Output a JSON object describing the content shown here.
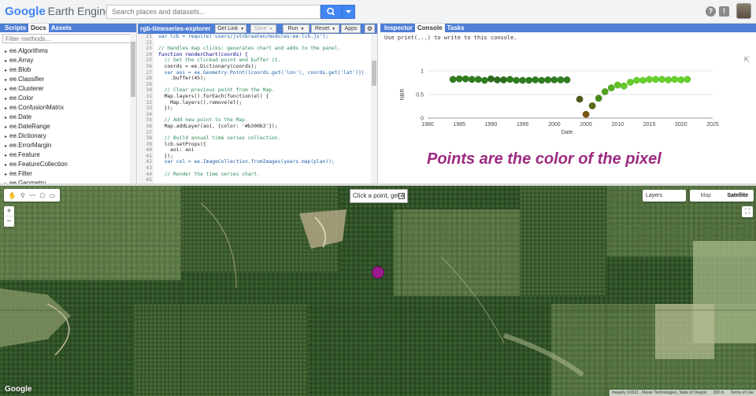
{
  "topbar": {
    "logo_google": "Google",
    "logo_product": "Earth Engine",
    "search_placeholder": "Search places and datasets...",
    "help_icon": "?",
    "feedback_icon": "!"
  },
  "left_panel": {
    "tabs": [
      "Scripts",
      "Docs",
      "Assets"
    ],
    "active_tab": "Docs",
    "filter_placeholder": "Filter methods...",
    "methods": [
      "ee.Algorithms",
      "ee.Array",
      "ee.Blob",
      "ee.Classifier",
      "ee.Clusterer",
      "ee.Color",
      "ee.ConfusionMatrix",
      "ee.Date",
      "ee.DateRange",
      "ee.Dictionary",
      "ee.ErrorMargin",
      "ee.Feature",
      "ee.FeatureCollection",
      "ee.Filter",
      "ee.Geometry"
    ]
  },
  "editor": {
    "title": "rgb-timeseries-explorer",
    "buttons": {
      "get_link": "Get Link",
      "save": "Save",
      "run": "Run",
      "reset": "Reset",
      "apps": "Apps"
    },
    "lines": [
      {
        "n": "21",
        "text": "var lcb = require('users/jstnbraaten/modules:ee-lcb.js');"
      },
      {
        "n": "22",
        "text": ""
      },
      {
        "n": "23",
        "text": "// Handles map clicks: generates chart and adds to the panel."
      },
      {
        "n": "24",
        "text": "function renderChart(coords) {"
      },
      {
        "n": "25",
        "text": "  // Get the clicked point and buffer it."
      },
      {
        "n": "26",
        "text": "  coords = ee.Dictionary(coords);"
      },
      {
        "n": "27",
        "text": "  var aoi = ee.Geometry.Point([coords.get('lon'), coords.get('lat')])"
      },
      {
        "n": "28",
        "text": "    .buffer(45);"
      },
      {
        "n": "29",
        "text": ""
      },
      {
        "n": "30",
        "text": "  // Clear previous point from the Map."
      },
      {
        "n": "31",
        "text": "  Map.layers().forEach(function(el) {"
      },
      {
        "n": "32",
        "text": "    Map.layers().remove(el);"
      },
      {
        "n": "33",
        "text": "  });"
      },
      {
        "n": "34",
        "text": ""
      },
      {
        "n": "35",
        "text": "  // Add new point to the Map."
      },
      {
        "n": "36",
        "text": "  Map.addLayer(aoi, {color: '#b300b3'});"
      },
      {
        "n": "37",
        "text": ""
      },
      {
        "n": "38",
        "text": "  // Build annual time series collection."
      },
      {
        "n": "39",
        "text": "  lcb.setProps({"
      },
      {
        "n": "40",
        "text": "    aoi: aoi"
      },
      {
        "n": "41",
        "text": "  });"
      },
      {
        "n": "42",
        "text": "  var col = ee.ImageCollection.fromImages(years.map(plan));"
      },
      {
        "n": "43",
        "text": ""
      },
      {
        "n": "44",
        "text": "  // Render the time series chart."
      },
      {
        "n": "45",
        "text": ""
      }
    ]
  },
  "right_panel": {
    "tabs": [
      "Inspector",
      "Console",
      "Tasks"
    ],
    "active_tab": "Console",
    "hint": "Use print(...) to write to this console.",
    "caption": "Points are the color of the pixel"
  },
  "chart_data": {
    "type": "scatter",
    "xlabel": "Date",
    "ylabel": "NBR",
    "xlim": [
      1980,
      2025
    ],
    "ylim": [
      0,
      1.0
    ],
    "xticks": [
      1980,
      1985,
      1990,
      1995,
      2000,
      2005,
      2010,
      2015,
      2020,
      2025
    ],
    "yticks": [
      0,
      0.5,
      1.0
    ],
    "points": [
      {
        "x": 1984,
        "y": 0.82,
        "color": "#2e7d1e"
      },
      {
        "x": 1985,
        "y": 0.83,
        "color": "#2e7d1e"
      },
      {
        "x": 1986,
        "y": 0.83,
        "color": "#2e7d1e"
      },
      {
        "x": 1987,
        "y": 0.82,
        "color": "#2e7d1e"
      },
      {
        "x": 1988,
        "y": 0.82,
        "color": "#2e7d1e"
      },
      {
        "x": 1989,
        "y": 0.8,
        "color": "#2e7d1e"
      },
      {
        "x": 1990,
        "y": 0.83,
        "color": "#2c6b1c"
      },
      {
        "x": 1991,
        "y": 0.81,
        "color": "#2c6b1c"
      },
      {
        "x": 1992,
        "y": 0.81,
        "color": "#2c6b1c"
      },
      {
        "x": 1993,
        "y": 0.82,
        "color": "#2e7d1e"
      },
      {
        "x": 1994,
        "y": 0.8,
        "color": "#2e7d1e"
      },
      {
        "x": 1995,
        "y": 0.8,
        "color": "#2e7d1e"
      },
      {
        "x": 1996,
        "y": 0.8,
        "color": "#2e7d1e"
      },
      {
        "x": 1997,
        "y": 0.81,
        "color": "#2e7d1e"
      },
      {
        "x": 1998,
        "y": 0.8,
        "color": "#2e7d1e"
      },
      {
        "x": 1999,
        "y": 0.81,
        "color": "#2e7d1e"
      },
      {
        "x": 2000,
        "y": 0.81,
        "color": "#2e7d1e"
      },
      {
        "x": 2001,
        "y": 0.81,
        "color": "#2e7d1e"
      },
      {
        "x": 2002,
        "y": 0.81,
        "color": "#2e7d1e"
      },
      {
        "x": 2004,
        "y": 0.4,
        "color": "#4d5a15"
      },
      {
        "x": 2005,
        "y": 0.08,
        "color": "#7a5a10"
      },
      {
        "x": 2006,
        "y": 0.26,
        "color": "#5a6a12"
      },
      {
        "x": 2007,
        "y": 0.42,
        "color": "#4a8a1a"
      },
      {
        "x": 2008,
        "y": 0.56,
        "color": "#52a020"
      },
      {
        "x": 2009,
        "y": 0.64,
        "color": "#58b022"
      },
      {
        "x": 2010,
        "y": 0.7,
        "color": "#5ec226"
      },
      {
        "x": 2011,
        "y": 0.68,
        "color": "#60c828"
      },
      {
        "x": 2012,
        "y": 0.76,
        "color": "#64cc2a"
      },
      {
        "x": 2013,
        "y": 0.8,
        "color": "#66d02c"
      },
      {
        "x": 2014,
        "y": 0.8,
        "color": "#66d02c"
      },
      {
        "x": 2015,
        "y": 0.82,
        "color": "#66d02c"
      },
      {
        "x": 2016,
        "y": 0.82,
        "color": "#66d02c"
      },
      {
        "x": 2017,
        "y": 0.82,
        "color": "#66d02c"
      },
      {
        "x": 2018,
        "y": 0.81,
        "color": "#66d02c"
      },
      {
        "x": 2019,
        "y": 0.82,
        "color": "#66d02c"
      },
      {
        "x": 2020,
        "y": 0.81,
        "color": "#66d02c"
      },
      {
        "x": 2021,
        "y": 0.82,
        "color": "#66d02c"
      }
    ]
  },
  "map": {
    "click_hint": "Click a point, get a",
    "layers_label": "Layers",
    "map_type_options": [
      "Map",
      "Satellite"
    ],
    "selected_map_type": "Satellite",
    "google_logo": "Google",
    "attribution": "Imagery ©2021 , Maxar Technologies, State of Oregon",
    "scale": "200 m",
    "terms": "Terms of Use",
    "marker_color": "#9c1a8e"
  }
}
